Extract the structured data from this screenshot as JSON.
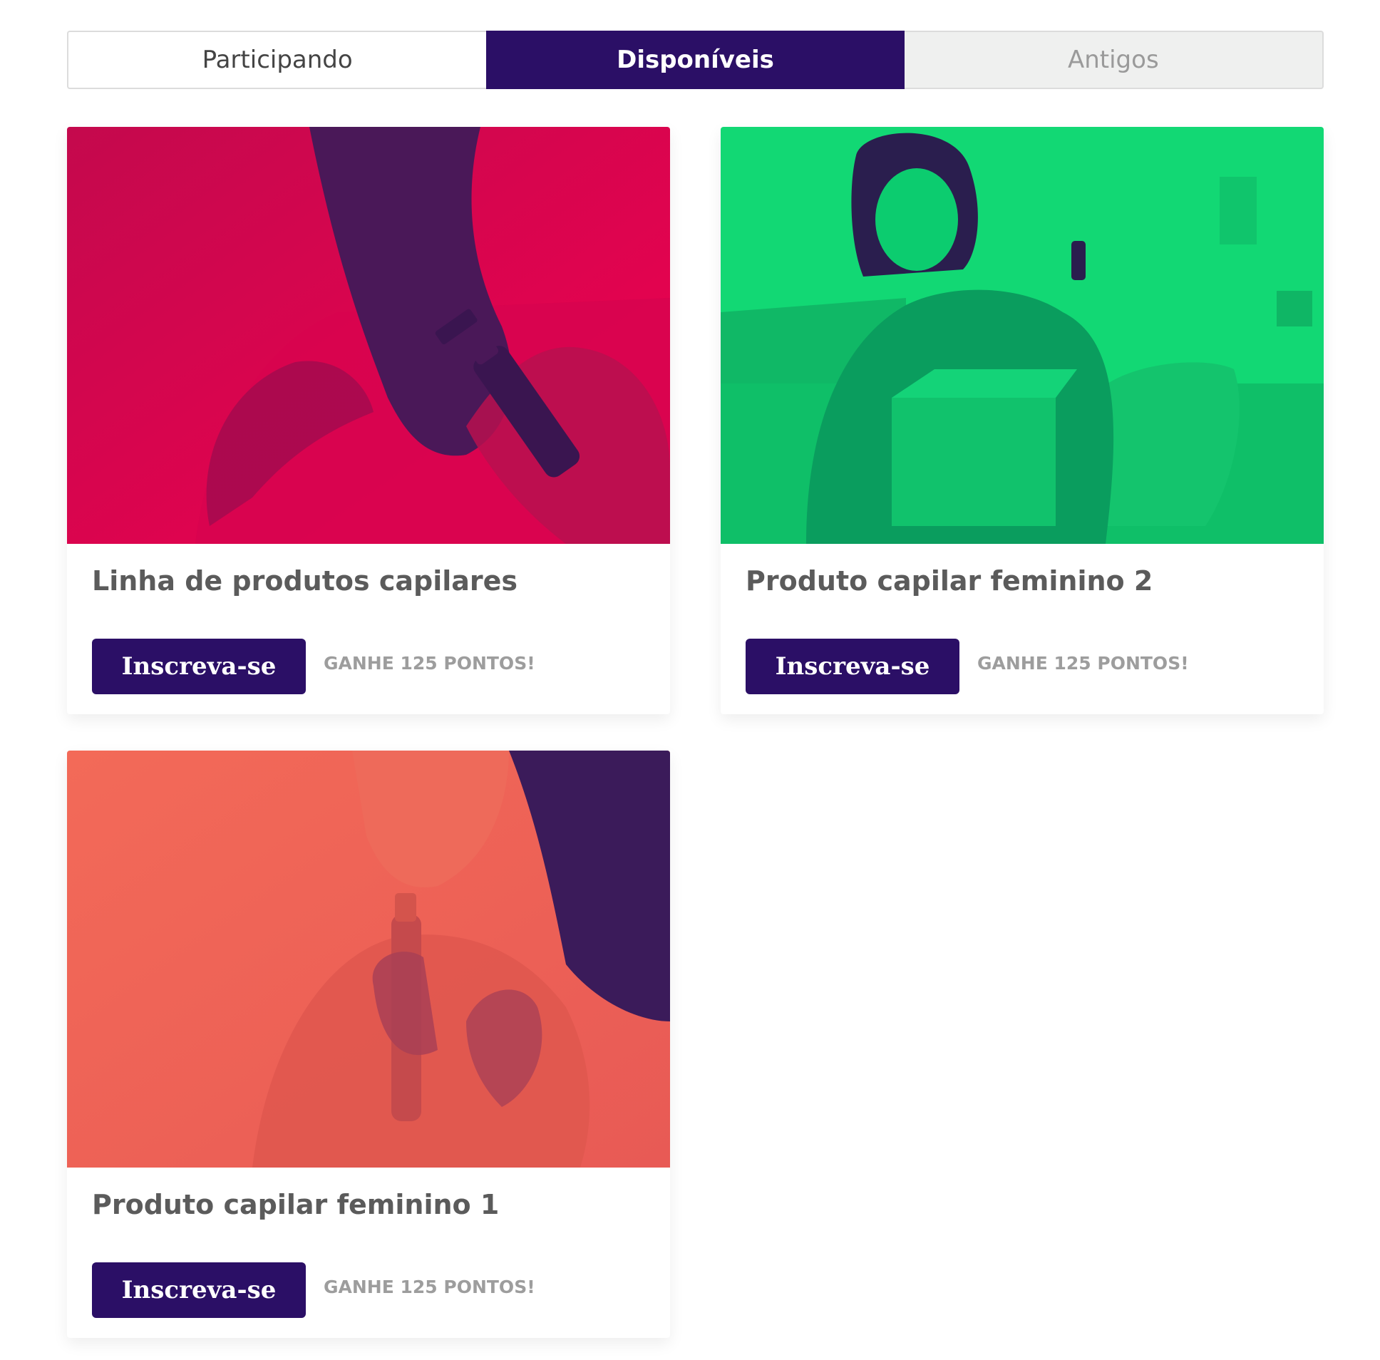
{
  "tabs": [
    {
      "label": "Participando"
    },
    {
      "label": "Disponíveis"
    },
    {
      "label": "Antigos"
    }
  ],
  "active_tab": "Disponíveis",
  "colors": {
    "accent": "#2b0f66",
    "card1_tint": "#e8084f",
    "card2_tint": "#12d874",
    "card3_tint": "#f4645a"
  },
  "cards": [
    {
      "title": "Linha de produtos capilares",
      "button_label": "Inscreva-se",
      "points_label": "GANHE 125 PONTOS!"
    },
    {
      "title": "Produto capilar feminino 2",
      "button_label": "Inscreva-se",
      "points_label": "GANHE 125 PONTOS!"
    },
    {
      "title": "Produto capilar feminino 1",
      "button_label": "Inscreva-se",
      "points_label": "GANHE 125 PONTOS!"
    }
  ]
}
